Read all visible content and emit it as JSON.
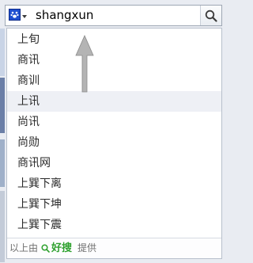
{
  "search": {
    "query": "shangxun",
    "engine_icon": "paw-icon",
    "submit_icon": "magnifier-icon"
  },
  "suggestions": [
    "上旬",
    "商讯",
    "商训",
    "上讯",
    "尚讯",
    "尚勋",
    "商讯网",
    "上巽下离",
    "上巽下坤",
    "上巽下震"
  ],
  "selected_index": 3,
  "footer": {
    "prefix": "以上由",
    "brand": "好搜",
    "suffix": "提供",
    "brand_color": "#2ea12e"
  },
  "colors": {
    "selected_bg": "#eef0f5",
    "engine_blue": "#1f4fd0"
  }
}
